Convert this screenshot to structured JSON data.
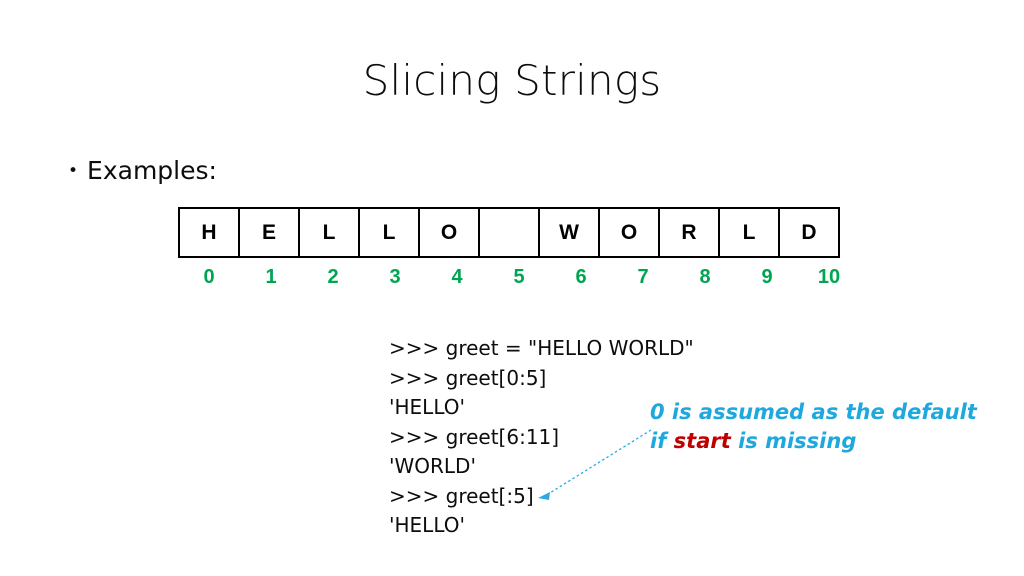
{
  "slide": {
    "title": "Slicing Strings",
    "bullet": {
      "marker": "•",
      "label": "Examples:"
    }
  },
  "string_table": {
    "cells": [
      "H",
      "E",
      "L",
      "L",
      "O",
      " ",
      "W",
      "O",
      "R",
      "L",
      "D"
    ],
    "indices": [
      "0",
      "1",
      "2",
      "3",
      "4",
      "5",
      "6",
      "7",
      "8",
      "9",
      "10"
    ],
    "index_color": "#00A550",
    "border_color": "#000000"
  },
  "code": {
    "lines": [
      ">>> greet = \"HELLO WORLD\"",
      ">>> greet[0:5]",
      "'HELLO'",
      ">>> greet[6:11]",
      "'WORLD'",
      ">>> greet[:5]",
      "'HELLO'"
    ]
  },
  "annotation": {
    "line1_part1": "0 is assumed as the default",
    "line2_part1": "if ",
    "line2_emphasis": "start",
    "line2_part2": " is missing",
    "text_color": "#1FA8DD",
    "emphasis_color": "#C00000",
    "arrow_color": "#29ABE2"
  }
}
